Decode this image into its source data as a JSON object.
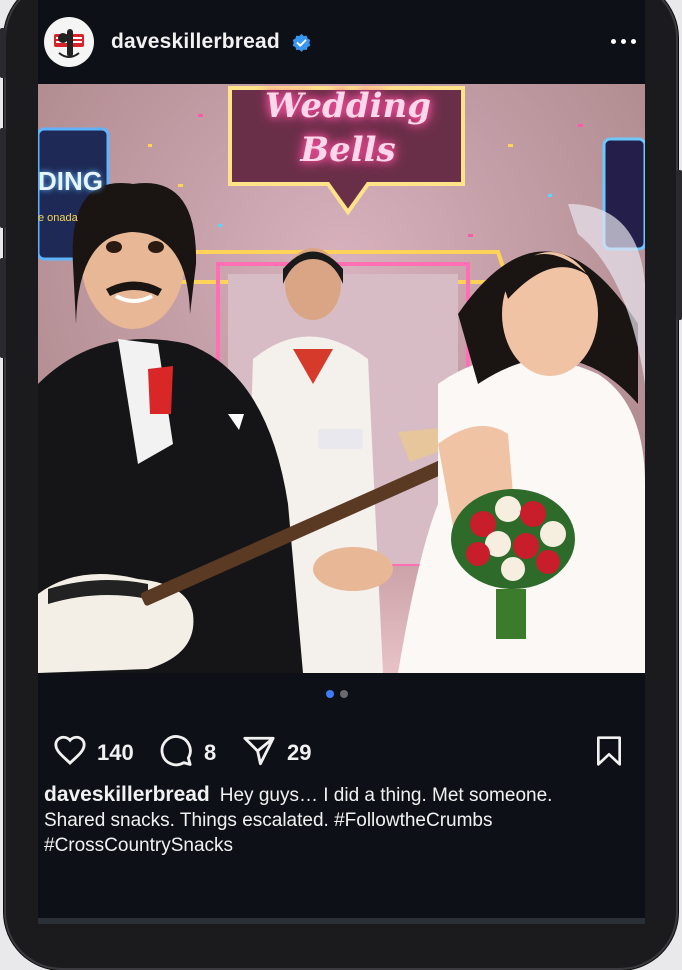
{
  "post": {
    "username": "daveskillerbread",
    "verified": true,
    "avatar_text": "DAVE'S KILLER BREAD",
    "image_sign_text_1": "Wedding",
    "image_sign_text_2": "Bells",
    "image_side_sign": "DING",
    "image_small_text": "e onada",
    "carousel": {
      "total": 2,
      "active_index": 0
    },
    "likes": "140",
    "comments": "8",
    "shares": "29",
    "caption_user": "daveskillerbread",
    "caption_text": "Hey guys… I did a thing. Met someone. Shared snacks. Things escalated. #FollowtheCrumbs #CrossCountrySnacks"
  },
  "icons": {
    "more": "more-options-icon",
    "verified": "verified-badge-icon",
    "like": "heart-icon",
    "comment": "comment-icon",
    "share": "send-icon",
    "save": "bookmark-icon"
  },
  "colors": {
    "background": "#0d1117",
    "text": "#f1f1f1",
    "verified": "#3897f0",
    "dot_active": "#3d7bf7",
    "dot_inactive": "#6a6a6f",
    "neon_pink": "#ff6fb3",
    "neon_yellow": "#f7d354"
  }
}
